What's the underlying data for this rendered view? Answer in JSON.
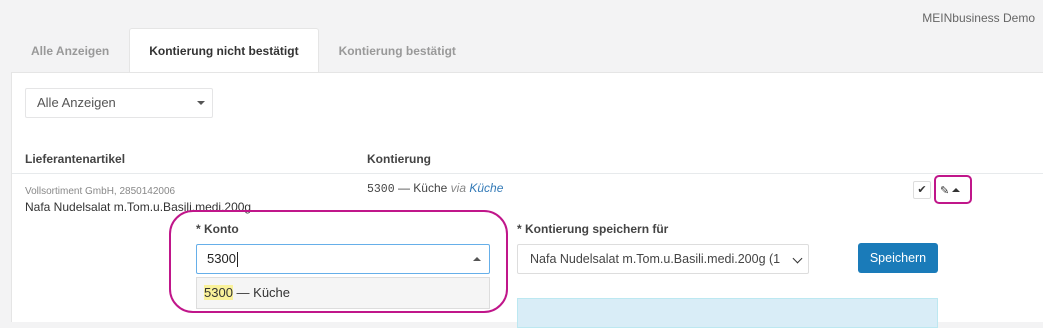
{
  "header": {
    "org_name": "MEINbusiness Demo"
  },
  "tabs": [
    {
      "label": "Alle Anzeigen",
      "active": false
    },
    {
      "label": "Kontierung nicht bestätigt",
      "active": true
    },
    {
      "label": "Kontierung bestätigt",
      "active": false
    }
  ],
  "filter": {
    "selected": "Alle Anzeigen"
  },
  "table": {
    "columns": [
      "Lieferantenartikel",
      "Kontierung"
    ],
    "rows": [
      {
        "supplier": "Vollsortiment GmbH, 2850142006",
        "article": "Nafa Nudelsalat m.Tom.u.Basili.medi.200g",
        "konto_code": "5300",
        "konto_name": "— Küche",
        "via_label": "via",
        "via_target": "Küche"
      }
    ]
  },
  "edit_form": {
    "konto_label": "* Konto",
    "konto_value": "5300",
    "konto_option": {
      "match": "5300",
      "rest": " — Küche"
    },
    "save_for_label": "* Kontierung speichern für",
    "save_for_value": "Nafa Nudelsalat m.Tom.u.Basili.medi.200g (1",
    "save_button": "Speichern"
  },
  "icons": {
    "confirm": "check-icon",
    "edit": "pencil-icon",
    "collapse": "caret-up-icon",
    "dropdown": "caret-down-icon"
  },
  "colors": {
    "highlight_outline": "#c0168a",
    "primary_button": "#1a7bb9",
    "match_highlight": "#f9f19a",
    "info_box": "#d9edf7"
  }
}
